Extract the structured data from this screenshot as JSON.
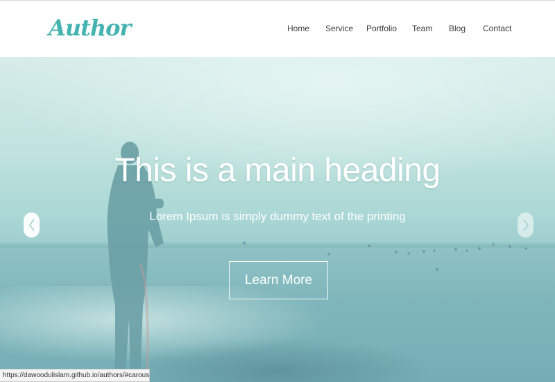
{
  "header": {
    "logo": "Author",
    "nav": [
      {
        "label": "Home",
        "name": "nav-home"
      },
      {
        "label": "Service",
        "name": "nav-service"
      },
      {
        "label": "Portfolio",
        "name": "nav-portfolio"
      },
      {
        "label": "Team",
        "name": "nav-team"
      },
      {
        "label": "Blog",
        "name": "nav-blog"
      },
      {
        "label": "Contact",
        "name": "nav-contact"
      }
    ]
  },
  "hero": {
    "heading": "This is a main heading",
    "subheading": "Lorem Ipsum is simply dummy text of the printing",
    "button_label": "Learn More",
    "prev_icon": "chevron-left-icon",
    "next_icon": "chevron-right-icon"
  },
  "status_bar": {
    "url": "https://dawoodulislam.github.io/authors/#carouselno"
  },
  "colors": {
    "brand": "#45b3b0",
    "nav_text": "#3a3a3a",
    "hero_text": "#ffffff"
  }
}
